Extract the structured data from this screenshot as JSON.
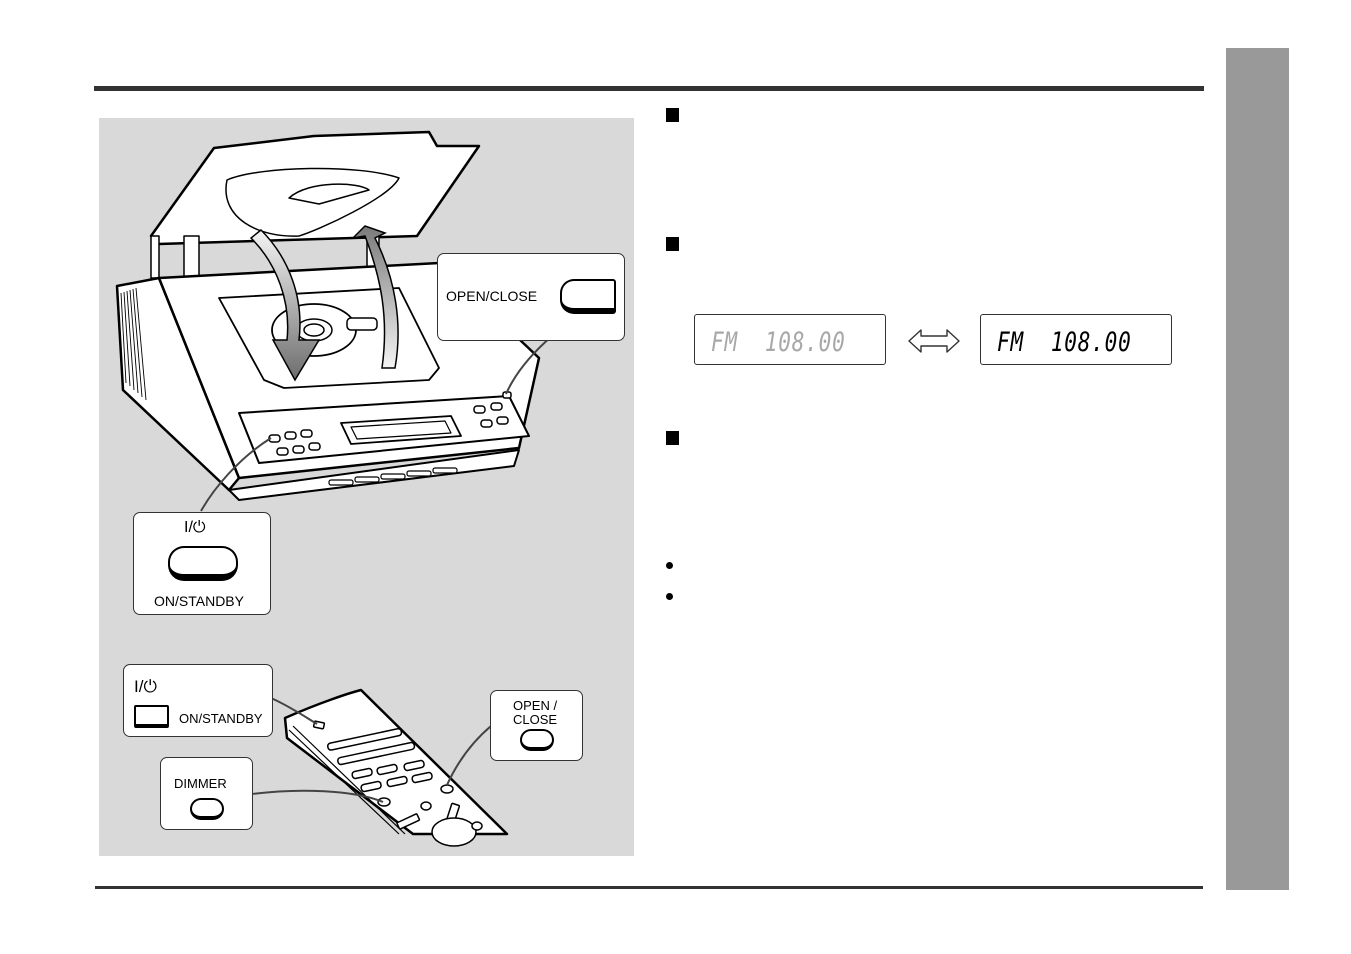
{
  "page": {
    "background": "#ffffff",
    "rule_color": "#333333",
    "side_tab_color": "#999999",
    "figure_bg": "#d9d9d9"
  },
  "figure": {
    "main_unit": {
      "open_close_callout": {
        "label": "OPEN/CLOSE"
      },
      "power_callout": {
        "symbol": "I/⏻",
        "label": "ON/STANDBY"
      }
    },
    "remote": {
      "power_callout": {
        "symbol": "I/⏻",
        "label": "ON/STANDBY"
      },
      "open_close_callout": {
        "label_line1": "OPEN /",
        "label_line2": "CLOSE"
      },
      "dimmer_callout": {
        "label": "DIMMER"
      }
    }
  },
  "sections": [
    {
      "bullet": "square"
    },
    {
      "bullet": "square"
    },
    {
      "bullet": "square"
    }
  ],
  "display_demo": {
    "dim_text": "FM  108.00",
    "bright_text": "FM  108.00",
    "dim_color": "#a8a8a8",
    "bright_color": "#000000",
    "arrow_icon": "double-arrow-horizontal"
  },
  "notes": [
    {
      "bullet": "dot"
    },
    {
      "bullet": "dot"
    }
  ]
}
